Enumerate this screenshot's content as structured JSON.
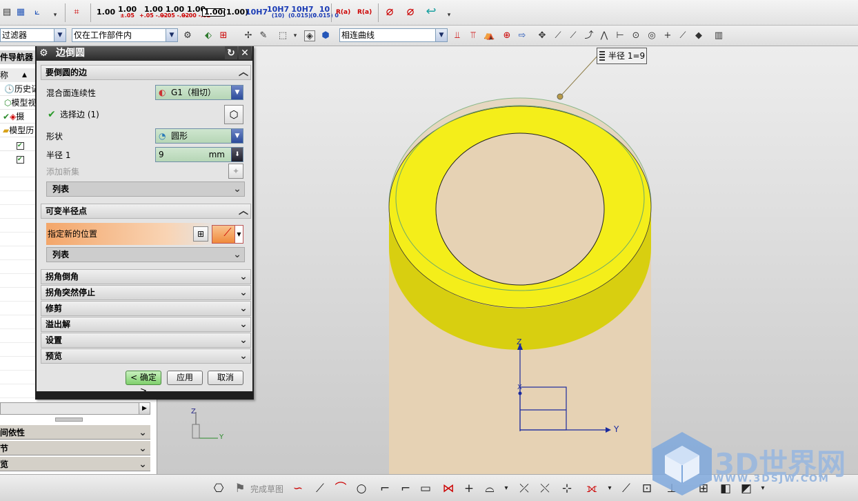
{
  "toolbar_top": {
    "dims": [
      {
        "main": "1.00",
        "tol": ""
      },
      {
        "main": "1.00",
        "tol": "±.05"
      },
      {
        "main": "1.00",
        "tol": "+.05 -.02"
      },
      {
        "main": "1.00",
        "tol": "+.05 -.02"
      },
      {
        "main": "1.00",
        "tol": "+.00 -.02"
      }
    ],
    "boxed_a": "1.00",
    "boxed_b": "(1.00)",
    "fit_1": "10H7",
    "fit_2": "10H7",
    "fit_2_sub": "(10)",
    "fit_3": "10H7",
    "fit_3_sub": "(0.015) 0",
    "fit_4": "10",
    "fit_4_sub": "(0.015) 0",
    "radius_a": "R(a)",
    "radius_b": "R(a)"
  },
  "toolbar_sel": {
    "filter_label": "过滤器",
    "scope_label": "仅在工作部件内",
    "curve_rule_label": "相连曲线"
  },
  "navigator": {
    "title": "件导航器",
    "col_name": "称",
    "items": [
      "历史记",
      "模型视",
      "摄",
      "模型历",
      "",
      ""
    ],
    "sections": [
      "间依性",
      "节",
      "览"
    ]
  },
  "dialog": {
    "title": "边倒圆",
    "group_edges": "要倒圆的边",
    "continuity_label": "混合面连续性",
    "continuity_value": "G1（相切）",
    "select_edge_label": "选择边 (1)",
    "shape_label": "形状",
    "shape_value": "圆形",
    "radius_label": "半径 1",
    "radius_value": "9",
    "radius_unit": "mm",
    "add_set_label": "添加新集",
    "list_label": "列表",
    "group_variable": "可变半径点",
    "specify_location": "指定新的位置",
    "list_label_2": "列表",
    "collapsed_groups": [
      "拐角倒角",
      "拐角突然停止",
      "修剪",
      "溢出解",
      "设置",
      "预览"
    ],
    "ok_label": "< 确定 >",
    "apply_label": "应用",
    "cancel_label": "取消"
  },
  "viewport": {
    "callout_label": "半径 1=9",
    "axis_z": "Z",
    "axis_y": "Y",
    "axis_x": "X",
    "triad_z": "Z",
    "triad_y": "Y"
  },
  "bottom_toolbar": {
    "finish_sketch_label": "完成草图"
  },
  "watermark": {
    "brand": "3D世界网",
    "url": "WWW.3DSJW.COM"
  },
  "colors": {
    "fillet_yellow": "#f4ee1a",
    "body_tan": "#e6d2b4",
    "dialog_title_bg": "#333333",
    "accent_orange": "#f3a66a"
  }
}
